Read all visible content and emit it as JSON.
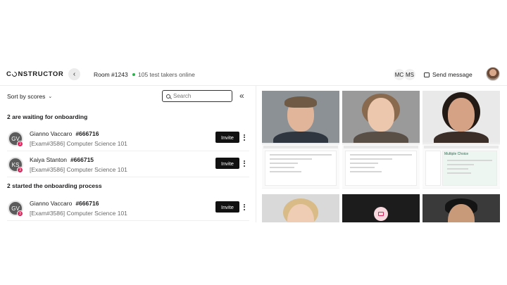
{
  "header": {
    "logo_left": "C",
    "logo_right": "NSTRUCTOR",
    "back_icon": "chevron-left-icon",
    "back_glyph": "‹",
    "room": "Room #1243",
    "online": "105 test takers online",
    "online_color": "#2bb24c",
    "proctors": [
      "MC",
      "MS"
    ],
    "send_message": "Send message"
  },
  "toolbar": {
    "sort_label": "Sort by scores",
    "search_placeholder": "Search",
    "collapse_glyph": "«"
  },
  "sections": [
    {
      "title": "2 are waiting for onboarding",
      "rows": [
        {
          "initials": "GV",
          "badge": "3",
          "name": "Gianno Vaccaro",
          "code": "#666716",
          "exam": "[Exam#3586] Computer Science 101",
          "action": "Invite"
        },
        {
          "initials": "KS",
          "badge": "3",
          "name": "Kaiya Stanton",
          "code": "#666715",
          "exam": "[Exam#3586] Computer Science 101",
          "action": "Invite"
        }
      ]
    },
    {
      "title": "2 started the onboarding process",
      "rows": [
        {
          "initials": "GV",
          "badge": "3",
          "name": "Gianno Vaccaro",
          "code": "#666716",
          "exam": "[Exam#3586] Computer Science 101",
          "action": "Invite"
        }
      ]
    }
  ],
  "gallery": {
    "third_tile_heading": "Multiple Choice"
  },
  "colors": {
    "accent_dark": "#111111",
    "badge": "#d6235a"
  }
}
